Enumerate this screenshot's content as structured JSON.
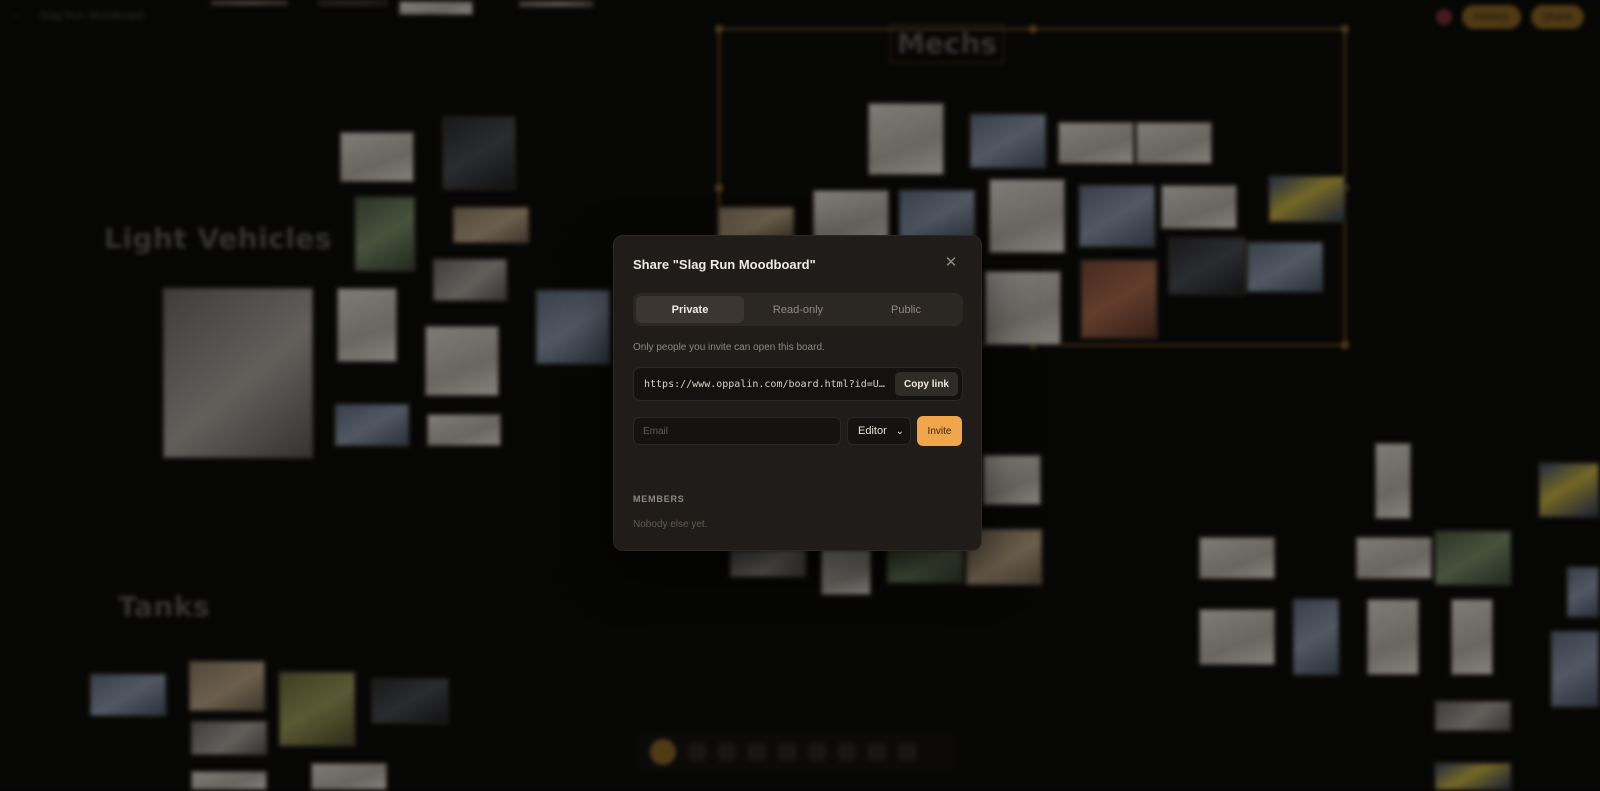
{
  "app": {
    "board_name": "Slag Run Moodboard",
    "actions": [
      "History",
      "Share"
    ]
  },
  "canvas": {
    "groups": [
      "Light Vehicles",
      "Mechs",
      "Tanks"
    ]
  },
  "share_dialog": {
    "title": "Share \"Slag Run Moodboard\"",
    "close_icon": "close-icon",
    "tabs": [
      {
        "label": "Private",
        "active": true
      },
      {
        "label": "Read-only",
        "active": false
      },
      {
        "label": "Public",
        "active": false
      }
    ],
    "hint": "Only people you invite can open this board.",
    "link": {
      "url": "https://www.oppalin.com/board.html?id=U7e0yC…",
      "copy_label": "Copy link"
    },
    "invite": {
      "email_placeholder": "Email",
      "email_value": "",
      "role_selected": "Editor",
      "button_label": "Invite"
    },
    "members": {
      "heading": "MEMBERS",
      "empty_text": "Nobody else yet."
    }
  },
  "colors": {
    "accent": "#f0a54a",
    "dialog_bg": "#1f1c19",
    "overlay": "rgba(0,0,0,0.42)"
  }
}
